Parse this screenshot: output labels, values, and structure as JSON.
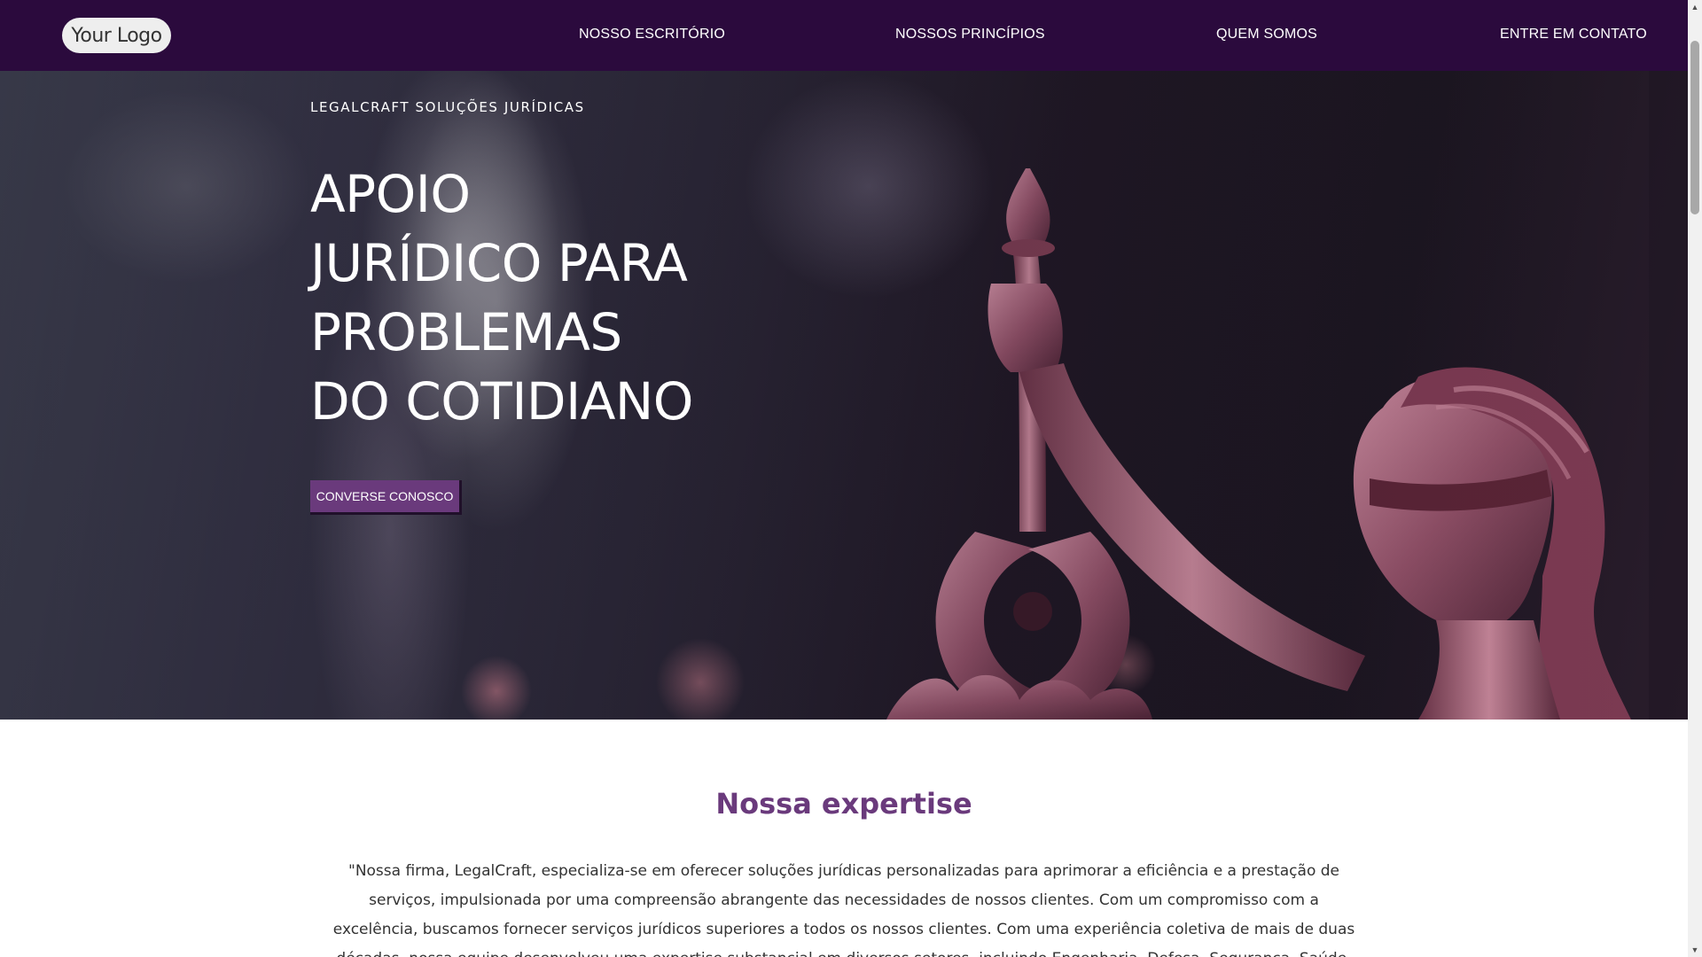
{
  "header": {
    "logo_text": "Your Logo",
    "nav": [
      {
        "label": "NOSSO ESCRITÓRIO"
      },
      {
        "label": "NOSSOS PRINCÍPIOS"
      },
      {
        "label": "QUEM SOMOS"
      },
      {
        "label": "ENTRE EM CONTATO"
      }
    ]
  },
  "hero": {
    "eyebrow": "LEGALCRAFT SOLUÇÕES JURÍDICAS",
    "title_lines": [
      "APOIO",
      "JURÍDICO PARA",
      "PROBLEMAS",
      "DO COTIDIANO"
    ],
    "cta_label": "CONVERSE CONOSCO"
  },
  "expertise": {
    "title": "Nossa expertise",
    "text": "\"Nossa firma, LegalCraft, especializa-se em oferecer soluções jurídicas personalizadas para aprimorar a eficiência e a prestação de serviços, impulsionada por uma compreensão abrangente das necessidades de nossos clientes. Com um compromisso com a excelência, buscamos fornecer serviços jurídicos superiores a todos os nossos clientes. Com uma experiência coletiva de mais de duas décadas, nossa equipe desenvolveu uma expertise substancial em diversos setores, incluindo Engenharia, Defesa, Segurança, Saúde, Tecnologia, Desenvolvimento de Software, Mídia, Logística, Varejo, Lazer, Franquias, TI"
  },
  "colors": {
    "header_bg": "#2b0a3d",
    "accent": "#6a3a7c",
    "text": "#333333"
  },
  "icons": {
    "scroll_up": "▲",
    "scroll_down": "▼"
  }
}
